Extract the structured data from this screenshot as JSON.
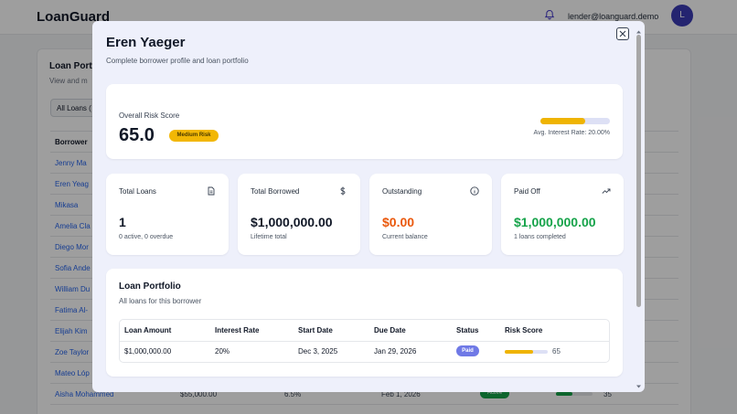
{
  "app": {
    "brand": "LoanGuard",
    "user_email": "lender@loanguard.demo",
    "avatar_initial": "L"
  },
  "background": {
    "title": "Loan Portf",
    "subtitle": "View and m",
    "filter_label": "All Loans (",
    "column_header": "Borrower",
    "rows": [
      {
        "name": "Jenny Ma"
      },
      {
        "name": "Eren Yeag"
      },
      {
        "name": "Mikasa"
      },
      {
        "name": "Amelia Cla"
      },
      {
        "name": "Diego Mor"
      },
      {
        "name": "Sofia Ande"
      },
      {
        "name": "William Du"
      },
      {
        "name": "Fatima Al-"
      },
      {
        "name": "Elijah Kim"
      },
      {
        "name": "Zoe Taylor"
      },
      {
        "name": "Mateo Lóp"
      },
      {
        "name": "Aisha Mohammed",
        "amount": "$55,000.00",
        "rate": "6.5%",
        "date": "Feb 1, 2026",
        "status": "Active",
        "score": "35"
      }
    ]
  },
  "modal": {
    "title": "Eren Yaeger",
    "subtitle": "Complete borrower profile and loan portfolio",
    "risk": {
      "label": "Overall Risk Score",
      "score": "65.0",
      "badge": "Medium Risk",
      "level_percent": 65,
      "interest_rate_text": "Avg. Interest Rate: 20.00%"
    },
    "stats": [
      {
        "label": "Total Loans",
        "icon": "document-icon",
        "value": "1",
        "note": "0 active, 0 overdue"
      },
      {
        "label": "Total Borrowed",
        "icon": "dollar-icon",
        "value": "$1,000,000.00",
        "note": "Lifetime total"
      },
      {
        "label": "Outstanding",
        "icon": "info-icon",
        "value": "$0.00",
        "note": "Current balance"
      },
      {
        "label": "Paid Off",
        "icon": "trending-up-icon",
        "value": "$1,000,000.00",
        "note": "1 loans completed"
      }
    ],
    "portfolio": {
      "title": "Loan Portfolio",
      "subtitle": "All loans for this borrower",
      "headers": [
        "Loan Amount",
        "Interest Rate",
        "Start Date",
        "Due Date",
        "Status",
        "Risk Score"
      ],
      "rows": [
        {
          "amount": "$1,000,000.00",
          "rate": "20%",
          "start": "Dec 3, 2025",
          "due": "Jan 29, 2026",
          "status": "Paid",
          "risk_score": "65",
          "risk_percent": 65
        }
      ]
    }
  },
  "colors": {
    "accent": "#3b3bb5",
    "warning": "#efb403",
    "outstanding": "#ea580c",
    "paid_off": "#16a34a",
    "status_paid": "#6f79e6"
  }
}
